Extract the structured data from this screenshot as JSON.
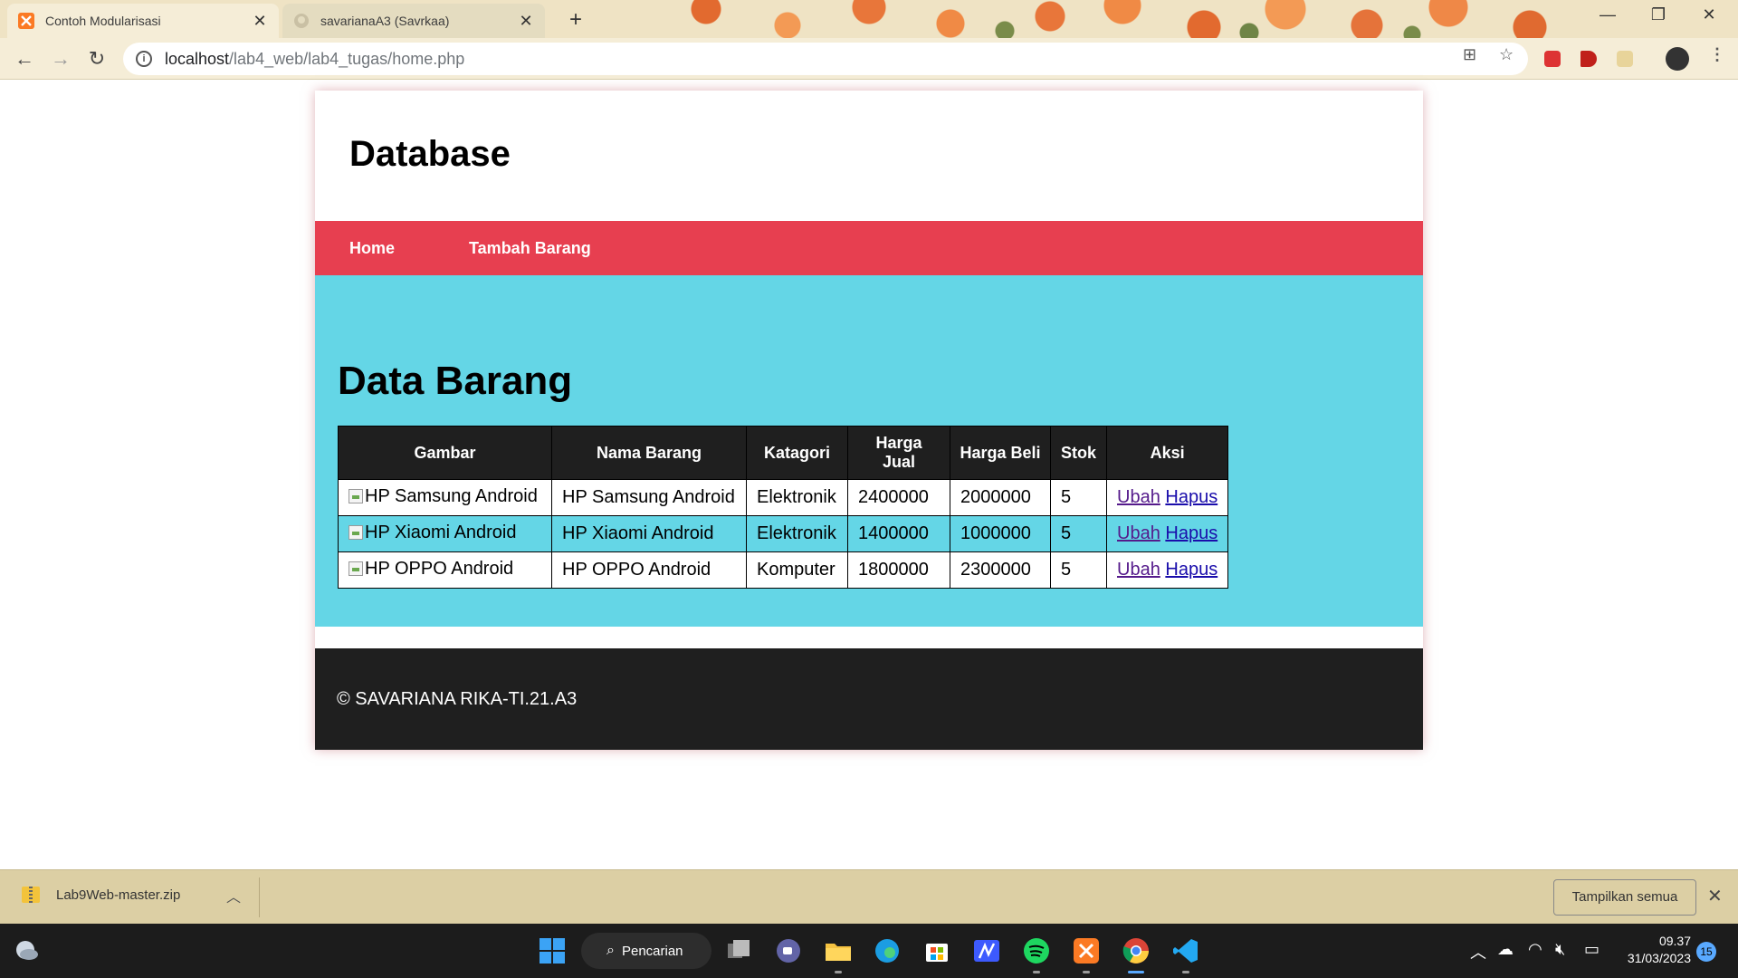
{
  "browser": {
    "tabs": [
      {
        "title": "Contoh Modularisasi",
        "active": true
      },
      {
        "title": "savarianaA3 (Savrkaa)",
        "active": false
      }
    ],
    "url_host": "localhost",
    "url_path": "/lab4_web/lab4_tugas/home.php"
  },
  "page": {
    "site_title": "Database",
    "nav": [
      "Home",
      "Tambah Barang"
    ],
    "heading": "Data Barang",
    "table": {
      "headers": [
        "Gambar",
        "Nama Barang",
        "Katagori",
        "Harga Jual",
        "Harga Beli",
        "Stok",
        "Aksi"
      ],
      "rows": [
        {
          "gambar": "HP Samsung Android",
          "nama": "HP Samsung Android",
          "kategori": "Elektronik",
          "harga_jual": "2400000",
          "harga_beli": "2000000",
          "stok": "5",
          "ubah": "Ubah",
          "hapus": "Hapus"
        },
        {
          "gambar": "HP Xiaomi Android",
          "nama": "HP Xiaomi Android",
          "kategori": "Elektronik",
          "harga_jual": "1400000",
          "harga_beli": "1000000",
          "stok": "5",
          "ubah": "Ubah",
          "hapus": "Hapus"
        },
        {
          "gambar": "HP OPPO Android",
          "nama": "HP OPPO Android",
          "kategori": "Komputer",
          "harga_jual": "1800000",
          "harga_beli": "2300000",
          "stok": "5",
          "ubah": "Ubah",
          "hapus": "Hapus"
        }
      ]
    },
    "footer": "© SAVARIANA RIKA-TI.21.A3"
  },
  "download_bar": {
    "filename": "Lab9Web-master.zip",
    "show_all": "Tampilkan semua"
  },
  "taskbar": {
    "search_label": "Pencarian",
    "time": "09.37",
    "date": "31/03/2023",
    "notification_count": "15"
  },
  "colors": {
    "nav_bg": "#e73f50",
    "main_bg": "#64d6e6",
    "table_header_bg": "#1f1f1f",
    "footer_bg": "#1f1f1f"
  }
}
